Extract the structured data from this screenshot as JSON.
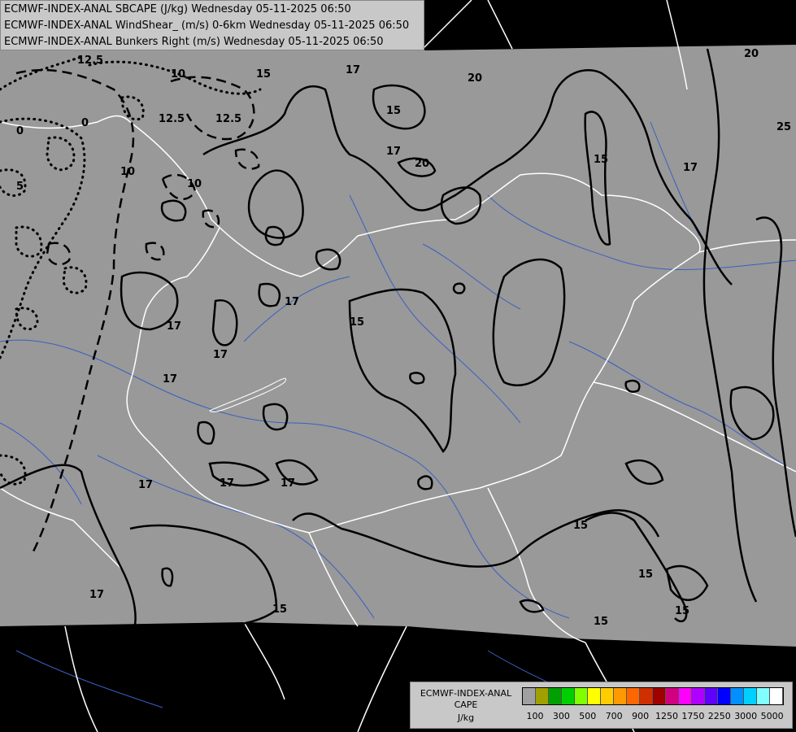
{
  "titles": {
    "line1": "ECMWF-INDEX-ANAL SBCAPE (J/kg) Wednesday 05-11-2025 06:50",
    "line2": "ECMWF-INDEX-ANAL WindShear_ (m/s) 0-6km Wednesday 05-11-2025 06:50",
    "line3": "ECMWF-INDEX-ANAL Bunkers Right (m/s) Wednesday 05-11-2025 06:50"
  },
  "legend": {
    "title1": "ECMWF-INDEX-ANAL",
    "title2": "CAPE",
    "title3": "J/kg",
    "colors": [
      "#a0a0a0",
      "#a0a000",
      "#00a000",
      "#00d000",
      "#80ff00",
      "#ffff00",
      "#ffcc00",
      "#ff9900",
      "#ff6600",
      "#d03000",
      "#a00000",
      "#d00080",
      "#ff00ff",
      "#b000ff",
      "#6000ff",
      "#0000ff",
      "#0090ff",
      "#00d0ff",
      "#80ffff",
      "#ffffff"
    ],
    "tick_labels": [
      "100",
      "300",
      "500",
      "700",
      "900",
      "1250",
      "1750",
      "2250",
      "3000",
      "5000"
    ]
  },
  "contour_labels": {
    "c10a": "10",
    "c125a": "12.5",
    "c125b": "12.5",
    "c125c": "12.5",
    "c15a": "15",
    "c15b": "15",
    "c15c": "15",
    "c15d": "15",
    "c15e": "15",
    "c15f": "15",
    "c15g": "15",
    "c15h": "15",
    "c17a": "17",
    "c17b": "17",
    "c17c": "17",
    "c17d": "17",
    "c17e": "17",
    "c17f": "17",
    "c17g": "17",
    "c17h": "17",
    "c17i": "17",
    "c17j": "17",
    "c20a": "20",
    "c20b": "20",
    "c20c": "20",
    "c25a": "25",
    "c0a": "0",
    "c0b": "0",
    "c5a": "5",
    "c10b": "10",
    "c10c": "10"
  }
}
